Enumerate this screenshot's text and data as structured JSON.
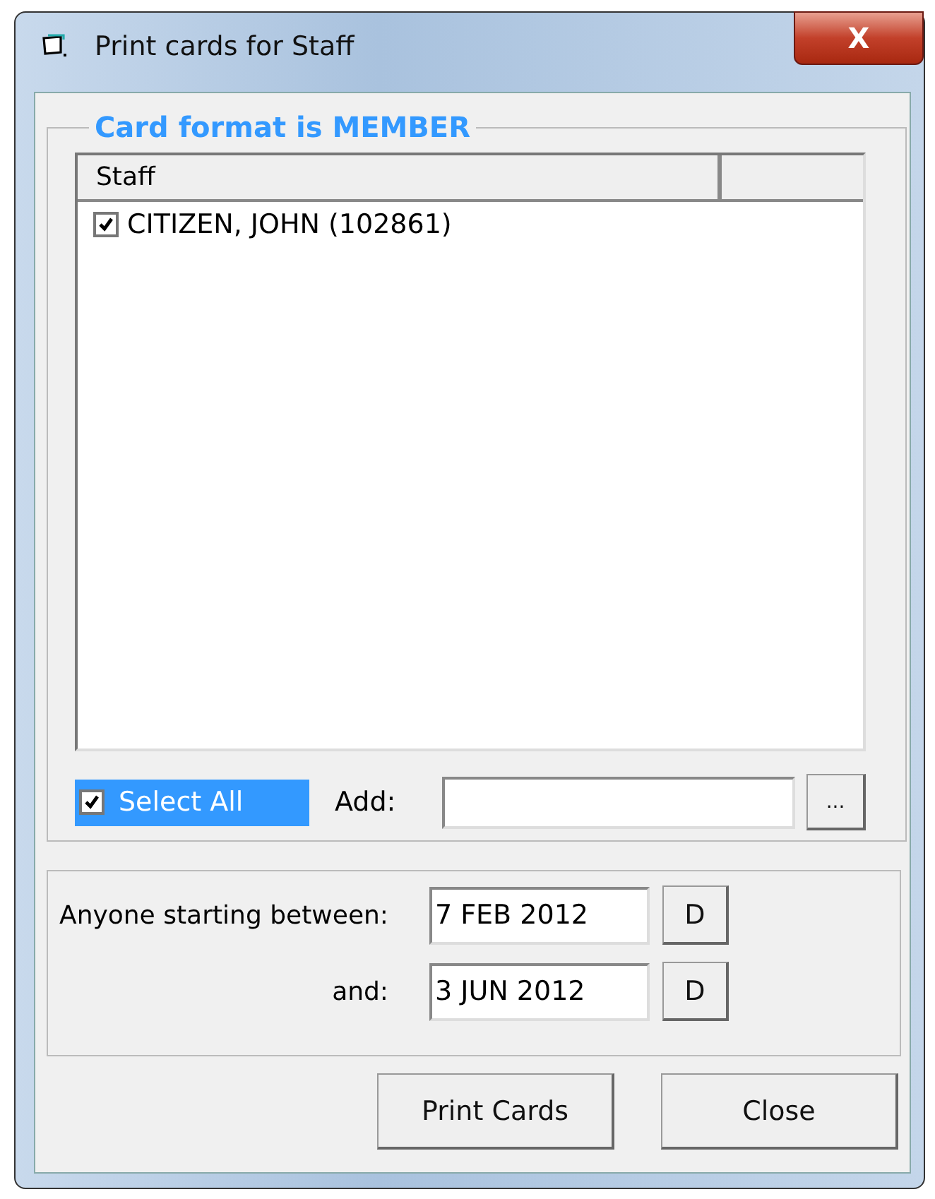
{
  "window": {
    "title": "Print cards for Staff",
    "close": "X"
  },
  "group_title": "Card format is MEMBER",
  "list": {
    "columns": [
      "Staff"
    ],
    "rows": [
      {
        "label": "CITIZEN, JOHN (102861)",
        "checked": true
      }
    ]
  },
  "select_all": {
    "label": "Select All",
    "checked": true,
    "selected": true
  },
  "add": {
    "label": "Add:",
    "browse": "..."
  },
  "dates": [
    {
      "label": "Anyone starting between:",
      "value": "7 FEB 2012",
      "button": "D"
    },
    {
      "label": "and:",
      "value": "3 JUN 2012",
      "button": "D"
    }
  ],
  "buttons": [
    "Print Cards",
    "Close"
  ]
}
